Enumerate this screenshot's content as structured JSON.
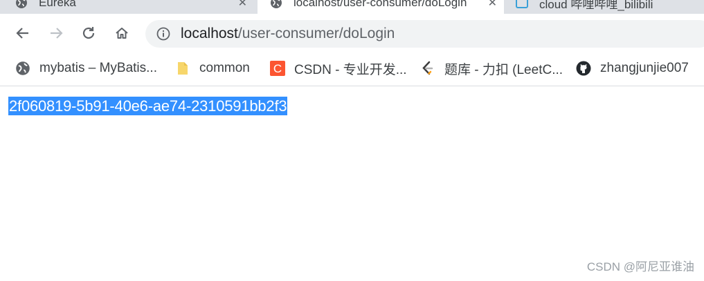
{
  "tabs": [
    {
      "title": "Eureka",
      "close_label": "✕"
    },
    {
      "title": "localhost/user-consumer/doLogin",
      "close_label": "✕"
    },
    {
      "title": "cloud 哔哩哔哩_bilibili"
    }
  ],
  "toolbar": {
    "back_icon": "arrow-left-icon",
    "forward_icon": "arrow-right-icon",
    "reload_icon": "reload-icon",
    "home_icon": "home-icon"
  },
  "address_bar": {
    "host": "localhost",
    "path": "/user-consumer/doLogin"
  },
  "bookmarks": [
    {
      "label": "mybatis – MyBatis...",
      "icon": "globe-icon"
    },
    {
      "label": "common",
      "icon": "folder-icon"
    },
    {
      "label": "CSDN - 专业开发...",
      "icon": "csdn-icon"
    },
    {
      "label": "题库 - 力扣 (LeetC...",
      "icon": "leetcode-icon"
    },
    {
      "label": "zhangjunjie007",
      "icon": "github-icon"
    }
  ],
  "content": {
    "selected_text": "2f060819-5b91-40e6-ae74-2310591bb2f3"
  },
  "watermark": "CSDN @阿尼亚谁油",
  "colors": {
    "selection": "#3390ff",
    "tabstrip": "#dee1e6",
    "omnibox": "#f1f3f4",
    "csdn": "#fc5531",
    "leetcode": "#ffa116"
  }
}
